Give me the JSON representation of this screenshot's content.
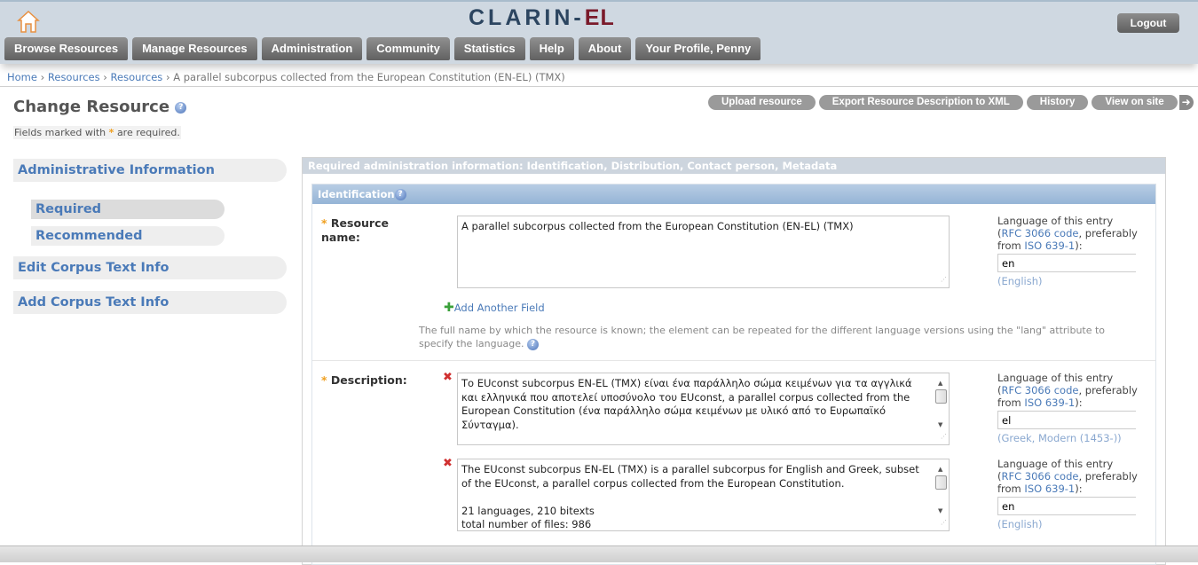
{
  "header": {
    "logo_main": "CLARIN-",
    "logo_accent": "EL",
    "logout": "Logout",
    "nav": [
      "Browse Resources",
      "Manage Resources",
      "Administration",
      "Community",
      "Statistics",
      "Help",
      "About",
      "Your Profile, Penny"
    ]
  },
  "breadcrumb": {
    "items": [
      "Home",
      "Resources",
      "Resources"
    ],
    "current": "A parallel subcorpus collected from the European Constitution (EN-EL) (TMX)",
    "separator": "›"
  },
  "page": {
    "title": "Change Resource",
    "required_note_pre": "Fields marked with",
    "required_note_post": "are required.",
    "star": "*"
  },
  "tools": {
    "upload": "Upload resource",
    "export": "Export Resource Description to XML",
    "history": "History",
    "view": "View on site"
  },
  "sidebar": {
    "admin": "Administrative Information",
    "required": "Required",
    "recommended": "Recommended",
    "edit_corpus": "Edit Corpus Text Info",
    "add_corpus": "Add Corpus Text Info"
  },
  "main": {
    "header": "Required administration information: Identification, Distribution, Contact person, Metadata",
    "section": "Identification",
    "lang_label_pre": "Language of this entry (",
    "lang_link1": "RFC 3066 code",
    "lang_label_mid": ", preferably from ",
    "lang_link2": "ISO 639-1",
    "lang_label_post": "):",
    "resource_name": {
      "label": "Resource name:",
      "value": "A parallel subcorpus collected from the European Constitution (EN-EL) (TMX)",
      "lang": "en",
      "lang_name": "(English)",
      "add": "Add Another Field",
      "hint": "The full name by which the resource is known; the element can be repeated for the different language versions using the \"lang\" attribute to specify the language."
    },
    "description": {
      "label": "Description:",
      "entries": [
        {
          "value": "Το EUconst subcorpus EN-EL (TMX) είναι ένα παράλληλο σώμα κειμένων για τα αγγλικά και ελληνικά που αποτελεί υποσύνολο του EUconst, a parallel corpus collected from the European Constitution (ένα παράλληλο σώμα κειμένων με υλικό από το Ευρωπαϊκό Σύνταγμα).",
          "lang": "el",
          "lang_name": "(Greek, Modern (1453-))"
        },
        {
          "value": "The EUconst subcorpus EN-EL (TMX) is a parallel subcorpus for English and Greek, subset of the EUconst, a parallel corpus collected from the European Constitution.\n\n21 languages, 210 bitexts\ntotal number of files: 986",
          "lang": "en",
          "lang_name": "(English)"
        }
      ]
    }
  }
}
